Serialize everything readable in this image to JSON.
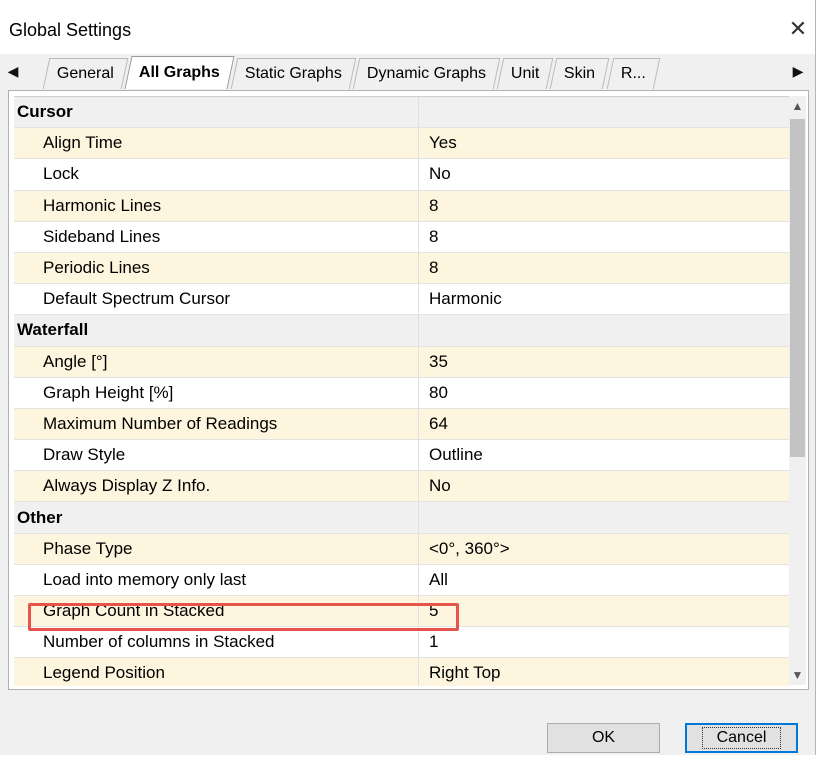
{
  "window": {
    "title": "Global Settings"
  },
  "tabs": [
    {
      "label": "General"
    },
    {
      "label": "All Graphs",
      "active": true
    },
    {
      "label": "Static Graphs"
    },
    {
      "label": "Dynamic Graphs"
    },
    {
      "label": "Unit"
    },
    {
      "label": "Skin"
    },
    {
      "label": "R..."
    }
  ],
  "grid": {
    "rows": [
      {
        "type": "section",
        "name": "Cursor"
      },
      {
        "name": "Align Time",
        "value": "Yes",
        "alt": true
      },
      {
        "name": "Lock",
        "value": "No"
      },
      {
        "name": "Harmonic Lines",
        "value": "8",
        "alt": true
      },
      {
        "name": "Sideband Lines",
        "value": "8"
      },
      {
        "name": "Periodic Lines",
        "value": "8",
        "alt": true
      },
      {
        "name": "Default Spectrum Cursor",
        "value": "Harmonic"
      },
      {
        "type": "section",
        "name": "Waterfall"
      },
      {
        "name": "Angle [°]",
        "value": "35",
        "alt": true
      },
      {
        "name": "Graph Height [%]",
        "value": "80"
      },
      {
        "name": "Maximum Number of Readings",
        "value": "64",
        "alt": true
      },
      {
        "name": "Draw Style",
        "value": "Outline"
      },
      {
        "name": "Always Display Z Info.",
        "value": "No",
        "alt": true
      },
      {
        "type": "section",
        "name": "Other"
      },
      {
        "name": "Phase Type",
        "value": "<0°, 360°>",
        "alt": true
      },
      {
        "name": "Load into memory only last",
        "value": "All"
      },
      {
        "name": "Graph Count in Stacked",
        "value": "5",
        "alt": true,
        "highlighted": true
      },
      {
        "name": "Number of columns in Stacked",
        "value": "1"
      },
      {
        "name": "Legend Position",
        "value": "Right Top",
        "alt": true
      }
    ]
  },
  "buttons": {
    "ok": "OK",
    "cancel": "Cancel"
  },
  "colors": {
    "alt_row": "#fdf5dd",
    "highlight": "#e5534b",
    "accent": "#0078d7"
  }
}
